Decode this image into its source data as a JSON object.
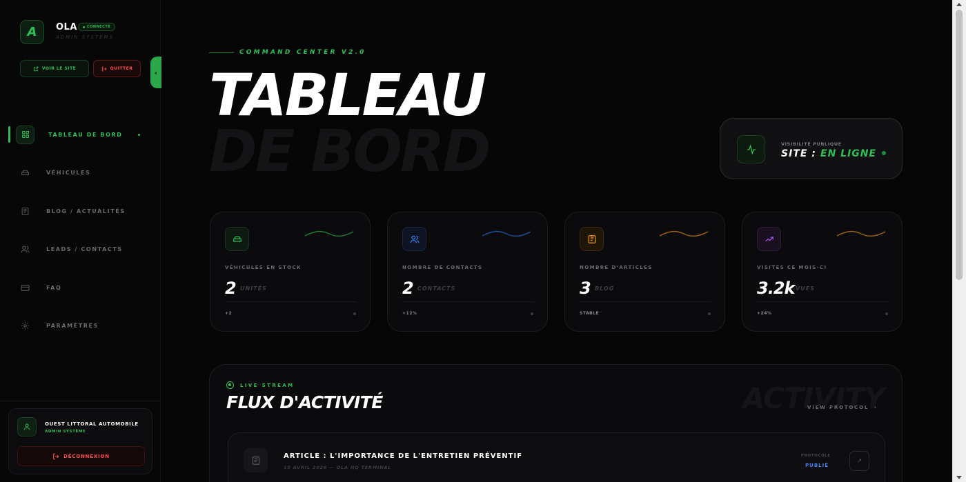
{
  "brand": {
    "logo_letter": "A",
    "name": "OLA",
    "subtitle": "ADMIN SYSTEMS",
    "status": "CONNECTÉ"
  },
  "actions": {
    "view_site": "VOIR LE SITE",
    "quit": "QUITTER"
  },
  "nav": [
    {
      "label": "TABLEAU DE BORD",
      "icon": "grid-icon",
      "active": true
    },
    {
      "label": "VÉHICULES",
      "icon": "car-icon",
      "active": false
    },
    {
      "label": "BLOG / ACTUALITÉS",
      "icon": "newspaper-icon",
      "active": false
    },
    {
      "label": "LEADS / CONTACTS",
      "icon": "users-icon",
      "active": false
    },
    {
      "label": "FAQ",
      "icon": "card-icon",
      "active": false
    },
    {
      "label": "PARAMÈTRES",
      "icon": "gear-icon",
      "active": false
    }
  ],
  "user": {
    "name": "OUEST LITTORAL AUTOMOBILE",
    "role": "ADMIN SYSTÈME",
    "logout": "DÉCONNEXION"
  },
  "header": {
    "kicker": "COMMAND CENTER V2.0",
    "title": "TABLEAU",
    "title_shadow": "DE BORD"
  },
  "visibility": {
    "label": "VISIBILITÉ PUBLIQUE",
    "site": "SITE :",
    "status": "EN LIGNE"
  },
  "stats": [
    {
      "label": "VÉHICULES EN STOCK",
      "value": "2",
      "unit": "UNITÉS",
      "trend": "+2",
      "color": "#2fbf55",
      "icon": "car-icon"
    },
    {
      "label": "NOMBRE DE CONTACTS",
      "value": "2",
      "unit": "CONTACTS",
      "trend": "+12%",
      "color": "#3b82f6",
      "icon": "users-icon"
    },
    {
      "label": "NOMBRE D'ARTICLES",
      "value": "3",
      "unit": "BLOG",
      "trend": "STABLE",
      "color": "#f59e0b",
      "icon": "newspaper-icon"
    },
    {
      "label": "VISITES CE MOIS-CI",
      "value": "3.2k",
      "unit": "VUES",
      "trend": "+24%",
      "color": "#a855f7",
      "icon": "trending-up-icon"
    }
  ],
  "feed": {
    "live": "LIVE STREAM",
    "title": "FLUX D'ACTIVITÉ",
    "bg_word": "ACTIVITY",
    "protocol_link": "VIEW PROTOCOL",
    "items": [
      {
        "title": "ARTICLE : L'IMPORTANCE DE L'ENTRETIEN PRÉVENTIF",
        "meta": "15 AVRIL 2026 — OLA HQ TERMINAL",
        "protocol_label": "PROTOCOLE",
        "status": "PUBLIÉ"
      }
    ]
  }
}
